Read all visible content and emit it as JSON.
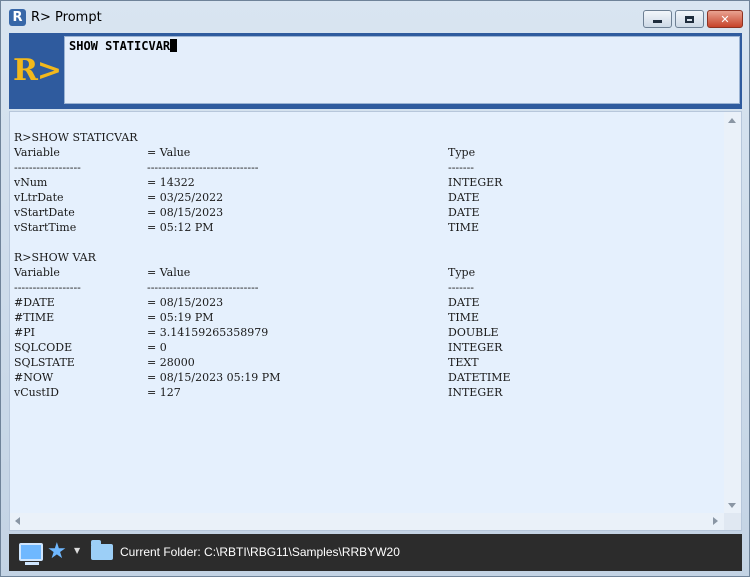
{
  "window": {
    "title": "R> Prompt",
    "app_icon": "R"
  },
  "command": {
    "logo": "R>",
    "value": "SHOW STATICVAR"
  },
  "output": {
    "lines": [
      {
        "c1": "R>SHOW STATICVAR",
        "c2": "",
        "c3": ""
      },
      {
        "c1": "Variable",
        "c2": "= Value",
        "c3": "Type"
      },
      {
        "c1": "------------------",
        "c2": "------------------------------",
        "c3": "-------"
      },
      {
        "c1": "vNum",
        "c2": "= 14322",
        "c3": "INTEGER"
      },
      {
        "c1": "vLtrDate",
        "c2": "= 03/25/2022",
        "c3": "DATE"
      },
      {
        "c1": "vStartDate",
        "c2": "= 08/15/2023",
        "c3": "DATE"
      },
      {
        "c1": "vStartTime",
        "c2": "= 05:12 PM",
        "c3": "TIME"
      },
      {
        "c1": "",
        "c2": "",
        "c3": ""
      },
      {
        "c1": "R>SHOW VAR",
        "c2": "",
        "c3": ""
      },
      {
        "c1": "Variable",
        "c2": "= Value",
        "c3": "Type"
      },
      {
        "c1": "------------------",
        "c2": "------------------------------",
        "c3": "-------"
      },
      {
        "c1": "#DATE",
        "c2": "= 08/15/2023",
        "c3": "DATE"
      },
      {
        "c1": "#TIME",
        "c2": "= 05:19 PM",
        "c3": "TIME"
      },
      {
        "c1": "#PI",
        "c2": "= 3.14159265358979",
        "c3": "DOUBLE"
      },
      {
        "c1": "SQLCODE",
        "c2": "= 0",
        "c3": "INTEGER"
      },
      {
        "c1": "SQLSTATE",
        "c2": "= 28000",
        "c3": "TEXT"
      },
      {
        "c1": "#NOW",
        "c2": "= 08/15/2023 05:19 PM",
        "c3": "DATETIME"
      },
      {
        "c1": "vCustID",
        "c2": "= 127",
        "c3": "INTEGER"
      }
    ]
  },
  "statusbar": {
    "folder_text": "Current Folder: C:\\RBTI\\RBG11\\Samples\\RRBYW20",
    "icons": [
      "monitor-icon",
      "star-icon",
      "chevron-down-icon",
      "folder-icon"
    ]
  },
  "colors": {
    "command_bg": "#2f5b9e",
    "logo": "#f2b81c",
    "output_bg": "#e5f0fd",
    "statusbar_bg": "#2c2c2c"
  }
}
